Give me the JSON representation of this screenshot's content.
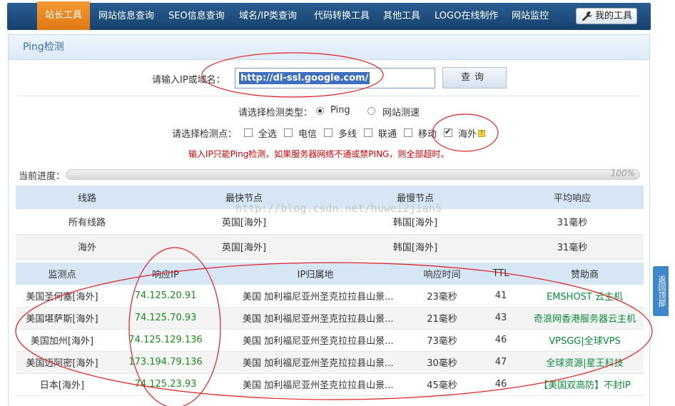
{
  "nav": {
    "active": "站长工具",
    "items": [
      "网站信息查询",
      "SEO信息查询",
      "域名/IP类查询",
      "代码转换工具",
      "其他工具",
      "LOGO在线制作",
      "网站监控"
    ],
    "tools_label": "我的工具"
  },
  "panel": {
    "title": "Ping检测",
    "input_label": "请输入IP或域名：",
    "input_value": "http://dl-ssl.google.com/",
    "query_label": "查询",
    "type_label": "请选择检测类型：",
    "type_ping": "Ping",
    "type_speed": "网站测速",
    "point_label": "请选择检测点：",
    "points": [
      {
        "label": "全选",
        "checked": false
      },
      {
        "label": "电信",
        "checked": false
      },
      {
        "label": "多线",
        "checked": false
      },
      {
        "label": "联通",
        "checked": false
      },
      {
        "label": "移动",
        "checked": false
      },
      {
        "label": "海外",
        "checked": true
      }
    ],
    "warning": "输入IP只能Ping检测，如果服务器网络不通或禁PING，则全部超时。",
    "progress_label": "当前进度：",
    "progress_value": "100%"
  },
  "summary": {
    "headers": [
      "线路",
      "最快节点",
      "最慢节点",
      "平均响应"
    ],
    "rows": [
      [
        "所有线路",
        "英国[海外]",
        "韩国[海外]",
        "31毫秒"
      ],
      [
        "海外",
        "英国[海外]",
        "韩国[海外]",
        "31毫秒"
      ]
    ]
  },
  "results": {
    "headers": [
      "监测点",
      "响应IP",
      "IP归属地",
      "响应时间",
      "TTL",
      "赞助商"
    ],
    "rows": [
      [
        "美国圣何塞[海外]",
        "74.125.20.91",
        "美国 加利福尼亚州圣克拉拉县山景...",
        "23毫秒",
        "41",
        "EMSHOST 云主机"
      ],
      [
        "美国堪萨斯[海外]",
        "74.125.70.93",
        "美国 加利福尼亚州圣克拉拉县山景...",
        "21毫秒",
        "43",
        "奇浪网香港服务器云主机"
      ],
      [
        "美国加州[海外]",
        "74.125.129.136",
        "美国 加利福尼亚州圣克拉拉县山景...",
        "73毫秒",
        "46",
        "VPSGG|全球VPS"
      ],
      [
        "美国迈阿密[海外]",
        "173.194.79.136",
        "美国 加利福尼亚州圣克拉拉县山景...",
        "30毫秒",
        "47",
        "全球资源|星王科技"
      ],
      [
        "日本[海外]",
        "74.125.23.93",
        "美国 加利福尼亚州圣克拉拉县山景...",
        "45毫秒",
        "46",
        "【美国双高防】不封IP"
      ]
    ]
  },
  "side_tab": "返回顶部",
  "watermark": "http://blog.csdn.net/huwei2jian5"
}
